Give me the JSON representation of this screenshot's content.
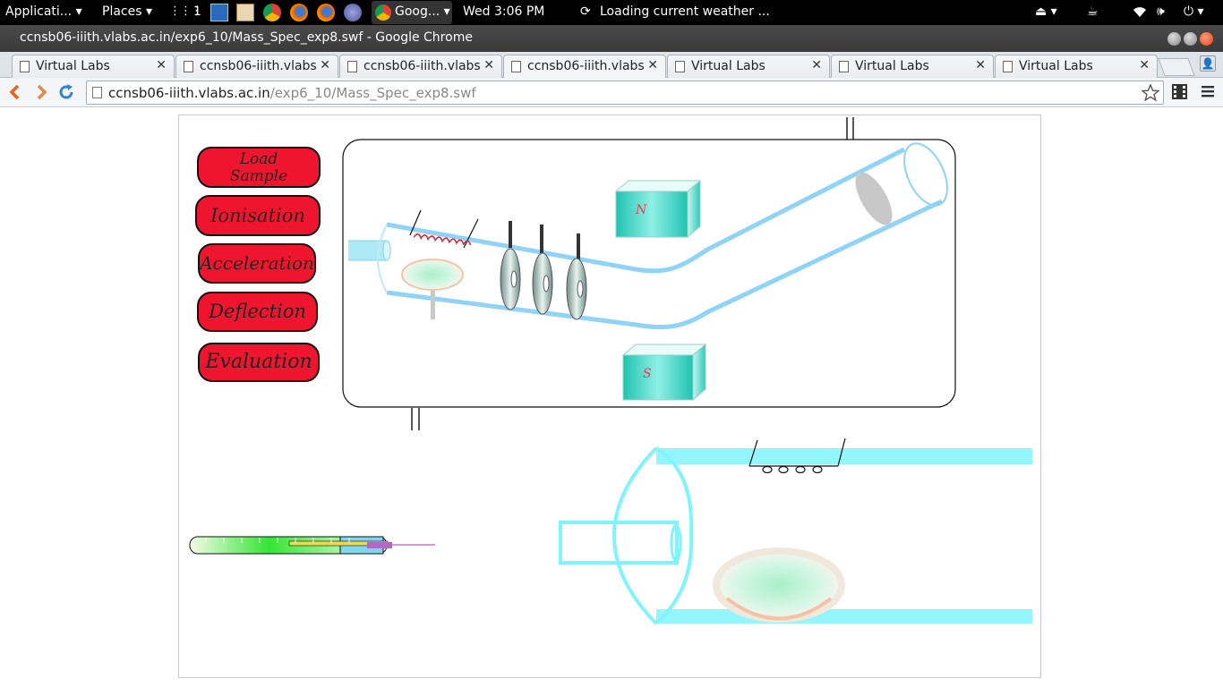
{
  "top_panel": {
    "applications": "Applicati...",
    "places": "Places",
    "workspace": "1",
    "chrome_task": "Goog...",
    "clock": "Wed  3:06 PM",
    "weather": "Loading current weather ..."
  },
  "window": {
    "title": "ccnsb06-iiith.vlabs.ac.in/exp6_10/Mass_Spec_exp8.swf - Google Chrome"
  },
  "tabs": [
    {
      "label": "Virtual Labs"
    },
    {
      "label": "ccnsb06-iiith.vlabs"
    },
    {
      "label": "ccnsb06-iiith.vlabs"
    },
    {
      "label": "ccnsb06-iiith.vlabs"
    },
    {
      "label": "Virtual Labs"
    },
    {
      "label": "Virtual Labs"
    },
    {
      "label": "Virtual Labs"
    }
  ],
  "toolbar": {
    "url_host": "ccnsb06-iiith.vlabs.ac.in",
    "url_path": "/exp6_10/Mass_Spec_exp8.swf"
  },
  "simulation": {
    "buttons": {
      "load_sample_line1": "Load",
      "load_sample_line2": "Sample",
      "ionisation": "Ionisation",
      "acceleration": "Acceleration",
      "deflection": "Deflection",
      "evaluation": "Evaluation"
    },
    "magnet_north": "N",
    "magnet_south": "S"
  },
  "colors": {
    "button_red": "#f0152f",
    "tube_cyan": "#7ff5fb",
    "magnet_teal": "#22c9b6"
  }
}
